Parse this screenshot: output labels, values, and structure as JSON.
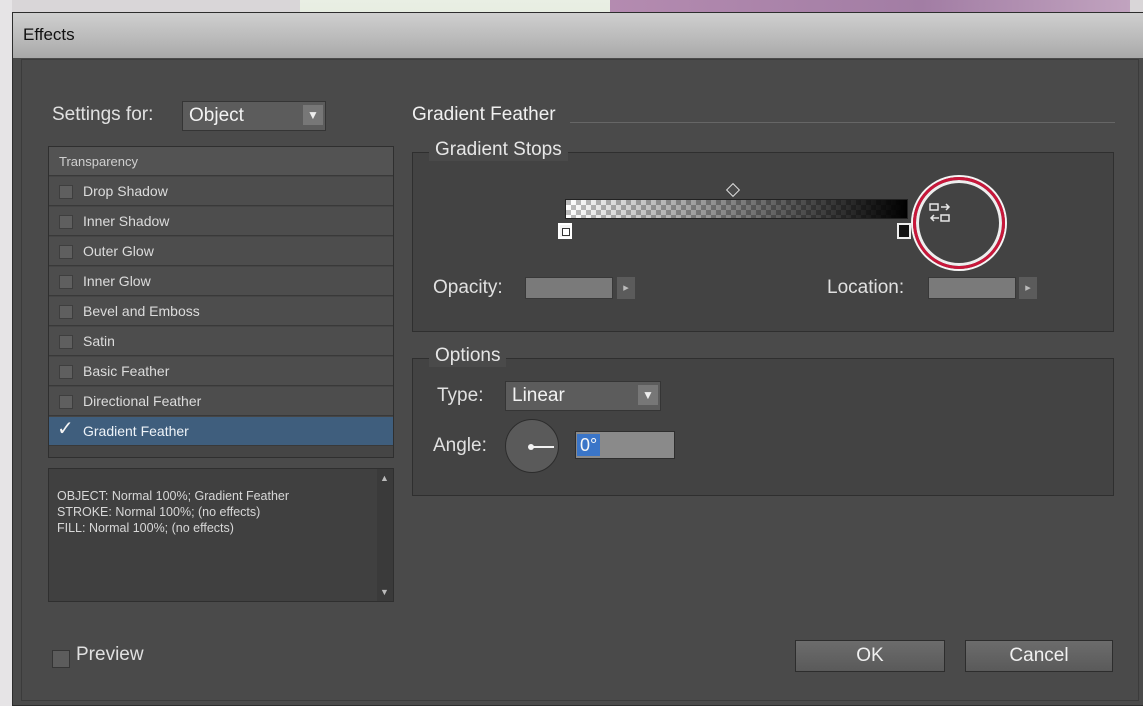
{
  "window": {
    "title": "Effects"
  },
  "settings": {
    "label": "Settings for:",
    "value": "Object"
  },
  "effects_list": {
    "header": "Transparency",
    "items": [
      {
        "label": "Drop Shadow",
        "checked": false
      },
      {
        "label": "Inner Shadow",
        "checked": false
      },
      {
        "label": "Outer Glow",
        "checked": false
      },
      {
        "label": "Inner Glow",
        "checked": false
      },
      {
        "label": "Bevel and Emboss",
        "checked": false
      },
      {
        "label": "Satin",
        "checked": false
      },
      {
        "label": "Basic Feather",
        "checked": false
      },
      {
        "label": "Directional Feather",
        "checked": false
      },
      {
        "label": "Gradient Feather",
        "checked": true,
        "selected": true
      }
    ]
  },
  "summary": {
    "lines": [
      "OBJECT: Normal 100%; Gradient Feather",
      "STROKE: Normal 100%; (no effects)",
      "FILL: Normal 100%; (no effects)"
    ]
  },
  "panel": {
    "title": "Gradient Feather",
    "gradient_stops": {
      "title": "Gradient Stops",
      "opacity_label": "Opacity:",
      "opacity_value": "",
      "location_label": "Location:",
      "location_value": "",
      "reverse_icon": "reverse-gradient-icon",
      "highlight_color": "#c8173a"
    },
    "options": {
      "title": "Options",
      "type_label": "Type:",
      "type_value": "Linear",
      "angle_label": "Angle:",
      "angle_value": "0°"
    }
  },
  "footer": {
    "preview_label": "Preview",
    "preview_checked": false,
    "ok_label": "OK",
    "cancel_label": "Cancel"
  },
  "colors": {
    "dialog_bg": "#4a4a4a",
    "selection": "#3f5e7d",
    "accent_selection": "#3a75c8"
  }
}
